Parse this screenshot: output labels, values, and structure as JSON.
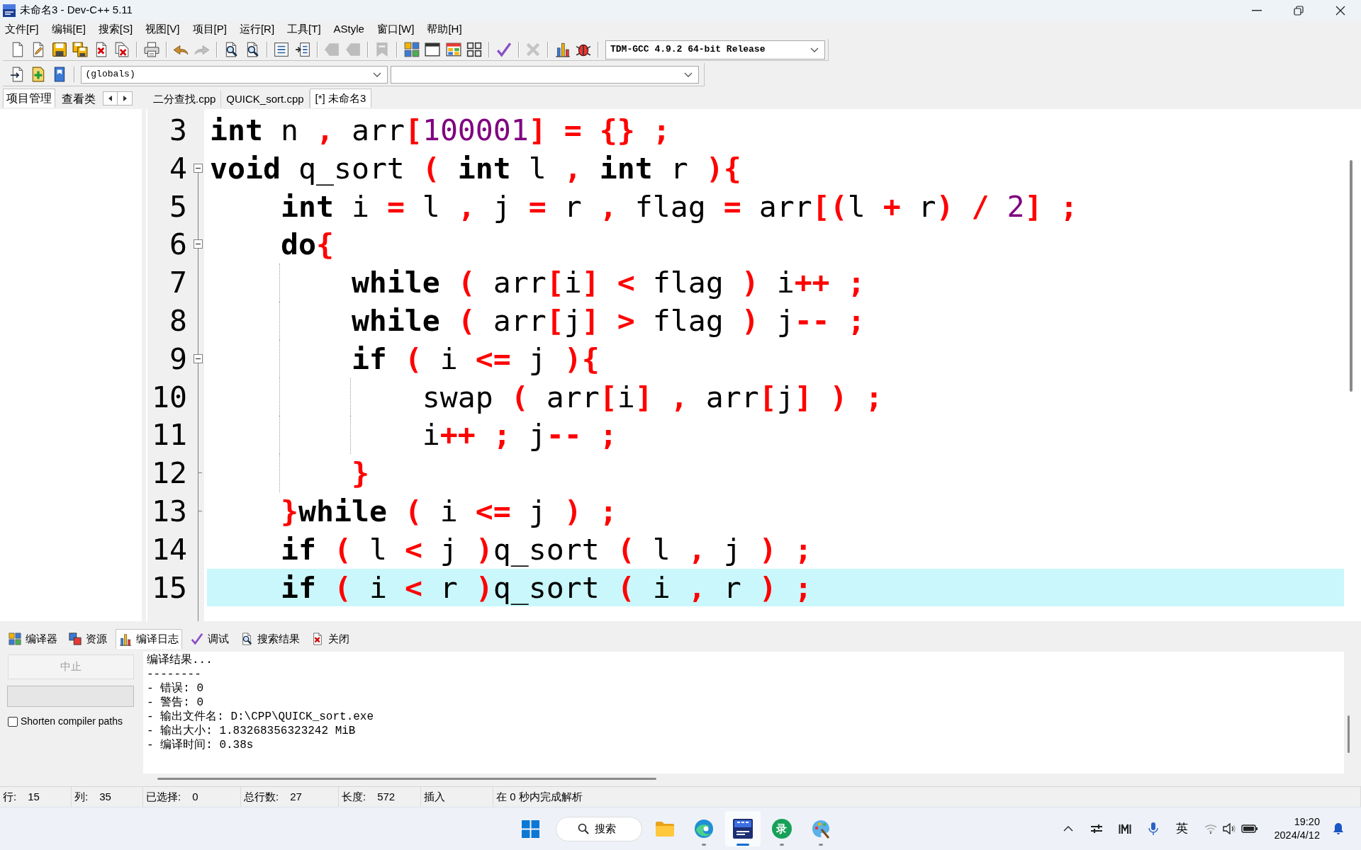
{
  "window": {
    "title": "未命名3 - Dev-C++ 5.11"
  },
  "menu": [
    "文件[F]",
    "编辑[E]",
    "搜索[S]",
    "视图[V]",
    "项目[P]",
    "运行[R]",
    "工具[T]",
    "AStyle",
    "窗口[W]",
    "帮助[H]"
  ],
  "main_toolbar": {
    "groups": [
      [
        {
          "kind": "new",
          "disabled": false
        },
        {
          "kind": "open",
          "disabled": false
        },
        {
          "kind": "save",
          "disabled": false
        },
        {
          "kind": "saveall",
          "disabled": false
        },
        {
          "kind": "close",
          "disabled": false
        },
        {
          "kind": "closeall",
          "disabled": false
        }
      ],
      [
        {
          "kind": "print",
          "disabled": false
        }
      ],
      [
        {
          "kind": "undo",
          "disabled": false
        },
        {
          "kind": "redo",
          "disabled": true
        }
      ],
      [
        {
          "kind": "find",
          "disabled": false
        },
        {
          "kind": "replace",
          "disabled": false
        }
      ],
      [
        {
          "kind": "indent",
          "disabled": false
        },
        {
          "kind": "unindent",
          "disabled": false
        }
      ],
      [
        {
          "kind": "back",
          "disabled": true
        },
        {
          "kind": "forward",
          "disabled": true
        }
      ],
      [
        {
          "kind": "bookmark",
          "disabled": true
        }
      ],
      [
        {
          "kind": "compile",
          "disabled": false
        },
        {
          "kind": "run",
          "disabled": false
        },
        {
          "kind": "compilerun",
          "disabled": false
        },
        {
          "kind": "rebuild",
          "disabled": false
        }
      ],
      [
        {
          "kind": "check",
          "disabled": false
        }
      ],
      [
        {
          "kind": "stop",
          "disabled": true
        }
      ],
      [
        {
          "kind": "profile",
          "disabled": false
        },
        {
          "kind": "debug",
          "disabled": false
        }
      ]
    ],
    "compiler": "TDM-GCC 4.9.2 64-bit Release"
  },
  "class_toolbar": {
    "buttons": [
      {
        "kind": "insert",
        "disabled": false
      },
      {
        "kind": "add",
        "disabled": false
      },
      {
        "kind": "bookmarks",
        "disabled": false
      }
    ],
    "scope": "(globals)"
  },
  "left_tabs": [
    {
      "label": "项目管理",
      "selected": true
    },
    {
      "label": "查看类",
      "selected": false
    }
  ],
  "editor_tabs": [
    {
      "label": "二分查找.cpp",
      "selected": false
    },
    {
      "label": "QUICK_sort.cpp",
      "selected": false
    },
    {
      "label": "[*] 未命名3",
      "selected": true
    }
  ],
  "code_lines": [
    {
      "number": "3",
      "current": false,
      "tokens": [
        {
          "kind": "keyword",
          "text": "int"
        },
        {
          "kind": "plain",
          "text": " n "
        },
        {
          "kind": "symbol",
          "text": ","
        },
        {
          "kind": "plain",
          "text": " arr"
        },
        {
          "kind": "symbol",
          "text": "["
        },
        {
          "kind": "number",
          "text": "100001"
        },
        {
          "kind": "symbol",
          "text": "] = {} ;"
        }
      ]
    },
    {
      "number": "4",
      "current": false,
      "tokens": [
        {
          "kind": "keyword",
          "text": "void"
        },
        {
          "kind": "plain",
          "text": " q_sort "
        },
        {
          "kind": "symbol",
          "text": "( "
        },
        {
          "kind": "keyword",
          "text": "int"
        },
        {
          "kind": "plain",
          "text": " l "
        },
        {
          "kind": "symbol",
          "text": ", "
        },
        {
          "kind": "keyword",
          "text": "int"
        },
        {
          "kind": "plain",
          "text": " r "
        },
        {
          "kind": "symbol",
          "text": "){"
        }
      ],
      "children": [
        {
          "number": "5",
          "current": false,
          "tokens": [
            {
              "kind": "keyword",
              "text": "int"
            },
            {
              "kind": "plain",
              "text": " i "
            },
            {
              "kind": "symbol",
              "text": "="
            },
            {
              "kind": "plain",
              "text": " l "
            },
            {
              "kind": "symbol",
              "text": ","
            },
            {
              "kind": "plain",
              "text": " j "
            },
            {
              "kind": "symbol",
              "text": "="
            },
            {
              "kind": "plain",
              "text": " r "
            },
            {
              "kind": "symbol",
              "text": ","
            },
            {
              "kind": "plain",
              "text": " flag "
            },
            {
              "kind": "symbol",
              "text": "="
            },
            {
              "kind": "plain",
              "text": " arr"
            },
            {
              "kind": "symbol",
              "text": "[("
            },
            {
              "kind": "plain",
              "text": "l "
            },
            {
              "kind": "symbol",
              "text": "+"
            },
            {
              "kind": "plain",
              "text": " r"
            },
            {
              "kind": "symbol",
              "text": ") / "
            },
            {
              "kind": "number",
              "text": "2"
            },
            {
              "kind": "symbol",
              "text": "] ;"
            }
          ]
        },
        {
          "number": "6",
          "current": false,
          "tokens": [
            {
              "kind": "keyword",
              "text": "do"
            },
            {
              "kind": "symbol",
              "text": "{"
            }
          ],
          "children": [
            {
              "number": "7",
              "current": false,
              "tokens": [
                {
                  "kind": "keyword",
                  "text": "while"
                },
                {
                  "kind": "symbol",
                  "text": " ("
                },
                {
                  "kind": "plain",
                  "text": " arr"
                },
                {
                  "kind": "symbol",
                  "text": "["
                },
                {
                  "kind": "plain",
                  "text": "i"
                },
                {
                  "kind": "symbol",
                  "text": "] <"
                },
                {
                  "kind": "plain",
                  "text": " flag "
                },
                {
                  "kind": "symbol",
                  "text": ")"
                },
                {
                  "kind": "plain",
                  "text": " i"
                },
                {
                  "kind": "symbol",
                  "text": "++ ;"
                }
              ]
            },
            {
              "number": "8",
              "current": false,
              "tokens": [
                {
                  "kind": "keyword",
                  "text": "while"
                },
                {
                  "kind": "symbol",
                  "text": " ("
                },
                {
                  "kind": "plain",
                  "text": " arr"
                },
                {
                  "kind": "symbol",
                  "text": "["
                },
                {
                  "kind": "plain",
                  "text": "j"
                },
                {
                  "kind": "symbol",
                  "text": "] >"
                },
                {
                  "kind": "plain",
                  "text": " flag "
                },
                {
                  "kind": "symbol",
                  "text": ")"
                },
                {
                  "kind": "plain",
                  "text": " j"
                },
                {
                  "kind": "symbol",
                  "text": "-- ;"
                }
              ]
            },
            {
              "number": "9",
              "current": false,
              "tokens": [
                {
                  "kind": "keyword",
                  "text": "if"
                },
                {
                  "kind": "symbol",
                  "text": " ("
                },
                {
                  "kind": "plain",
                  "text": " i "
                },
                {
                  "kind": "symbol",
                  "text": "<="
                },
                {
                  "kind": "plain",
                  "text": " j "
                },
                {
                  "kind": "symbol",
                  "text": "){"
                }
              ],
              "children": [
                {
                  "number": "10",
                  "current": false,
                  "tokens": [
                    {
                      "kind": "plain",
                      "text": "swap "
                    },
                    {
                      "kind": "symbol",
                      "text": "("
                    },
                    {
                      "kind": "plain",
                      "text": " arr"
                    },
                    {
                      "kind": "symbol",
                      "text": "["
                    },
                    {
                      "kind": "plain",
                      "text": "i"
                    },
                    {
                      "kind": "symbol",
                      "text": "] ,"
                    },
                    {
                      "kind": "plain",
                      "text": " arr"
                    },
                    {
                      "kind": "symbol",
                      "text": "["
                    },
                    {
                      "kind": "plain",
                      "text": "j"
                    },
                    {
                      "kind": "symbol",
                      "text": "] ) ;"
                    }
                  ]
                },
                {
                  "number": "11",
                  "current": false,
                  "tokens": [
                    {
                      "kind": "plain",
                      "text": "i"
                    },
                    {
                      "kind": "symbol",
                      "text": "++ ;"
                    },
                    {
                      "kind": "plain",
                      "text": " j"
                    },
                    {
                      "kind": "symbol",
                      "text": "-- ;"
                    }
                  ]
                }
              ]
            },
            {
              "number": "12",
              "current": false,
              "tokens": [
                {
                  "kind": "symbol",
                  "text": "}"
                }
              ]
            }
          ]
        },
        {
          "number": "13",
          "current": false,
          "tokens": [
            {
              "kind": "symbol",
              "text": "}"
            },
            {
              "kind": "keyword",
              "text": "while"
            },
            {
              "kind": "symbol",
              "text": " ("
            },
            {
              "kind": "plain",
              "text": " i "
            },
            {
              "kind": "symbol",
              "text": "<="
            },
            {
              "kind": "plain",
              "text": " j "
            },
            {
              "kind": "symbol",
              "text": ") ;"
            }
          ]
        },
        {
          "number": "14",
          "current": false,
          "tokens": [
            {
              "kind": "keyword",
              "text": "if"
            },
            {
              "kind": "symbol",
              "text": " ("
            },
            {
              "kind": "plain",
              "text": " l "
            },
            {
              "kind": "symbol",
              "text": "<"
            },
            {
              "kind": "plain",
              "text": " j "
            },
            {
              "kind": "symbol",
              "text": ")"
            },
            {
              "kind": "plain",
              "text": "q_sort "
            },
            {
              "kind": "symbol",
              "text": "("
            },
            {
              "kind": "plain",
              "text": " l "
            },
            {
              "kind": "symbol",
              "text": ","
            },
            {
              "kind": "plain",
              "text": " j "
            },
            {
              "kind": "symbol",
              "text": ") ;"
            }
          ]
        },
        {
          "number": "15",
          "current": true,
          "tokens": [
            {
              "kind": "keyword",
              "text": "if"
            },
            {
              "kind": "symbol",
              "text": " ("
            },
            {
              "kind": "plain",
              "text": " i "
            },
            {
              "kind": "symbol",
              "text": "<"
            },
            {
              "kind": "plain",
              "text": " r "
            },
            {
              "kind": "symbol",
              "text": ")"
            },
            {
              "kind": "plain",
              "text": "q_sort "
            },
            {
              "kind": "symbol",
              "text": "("
            },
            {
              "kind": "plain",
              "text": " i "
            },
            {
              "kind": "symbol",
              "text": ","
            },
            {
              "kind": "plain",
              "text": " r "
            },
            {
              "kind": "symbol",
              "text": ") ;"
            }
          ]
        }
      ]
    }
  ],
  "bottom_tabs": [
    {
      "kind": "compiler",
      "label": "编译器",
      "selected": false
    },
    {
      "kind": "resources",
      "label": "资源",
      "selected": false
    },
    {
      "kind": "log",
      "label": "编译日志",
      "selected": true
    },
    {
      "kind": "debug",
      "label": "调试",
      "selected": false
    },
    {
      "kind": "search",
      "label": "搜索结果",
      "selected": false
    },
    {
      "kind": "close",
      "label": "关闭",
      "selected": false
    }
  ],
  "compile_panel": {
    "abort_button": {
      "label": "中止",
      "disabled": true
    },
    "shorten_paths": {
      "label": "Shorten compiler paths",
      "checked": false
    },
    "log": [
      "编译结果...",
      "--------",
      "- 错误: 0",
      "- 警告: 0",
      "- 输出文件名: D:\\CPP\\QUICK_sort.exe",
      "- 输出大小: 1.83268356323242 MiB",
      "- 编译时间: 0.38s"
    ]
  },
  "status_bar": [
    {
      "label": "行:",
      "value": "15"
    },
    {
      "label": "列:",
      "value": "35"
    },
    {
      "label": "已选择:",
      "value": "0"
    },
    {
      "label": "总行数:",
      "value": "27"
    },
    {
      "label": "长度:",
      "value": "572"
    },
    {
      "text": "插入"
    },
    {
      "text": "在 0 秒内完成解析"
    }
  ],
  "taskbar": {
    "search": "搜索",
    "apps": [
      {
        "kind": "folder",
        "running": false,
        "active": false
      },
      {
        "kind": "browser",
        "running": true,
        "active": false
      },
      {
        "kind": "devcpp",
        "running": true,
        "active": true
      },
      {
        "kind": "recorder",
        "label": "录",
        "running": true,
        "active": false
      },
      {
        "kind": "paint",
        "running": true,
        "active": false
      }
    ],
    "language": "英",
    "time": "19:20",
    "date": "2024/4/12"
  }
}
